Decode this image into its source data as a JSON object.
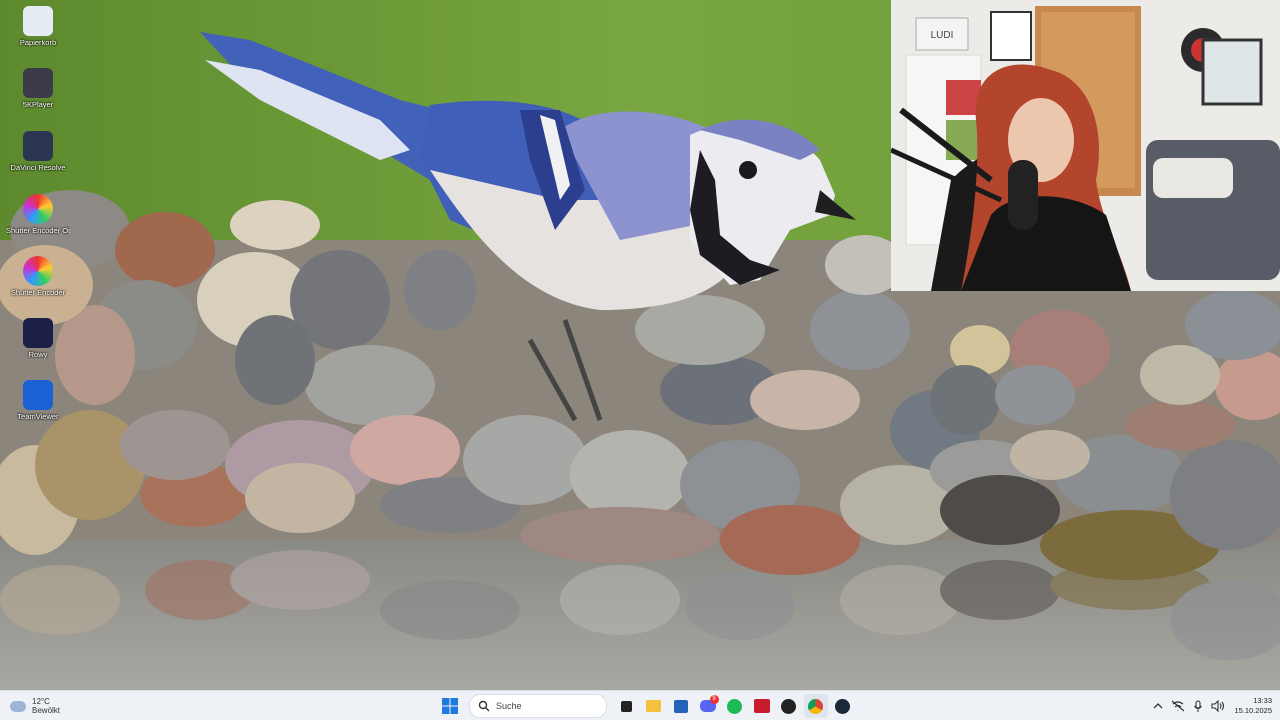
{
  "desktop": {
    "icons": [
      {
        "id": "recycle",
        "label": "Papierkorb"
      },
      {
        "id": "5kplayer",
        "label": "5KPlayer"
      },
      {
        "id": "davinci",
        "label": "DaVinci Resolve"
      },
      {
        "id": "encoder-opencl",
        "label": "Shutter Encoder OpenCL"
      },
      {
        "id": "encoder",
        "label": "Shutter Encoder"
      },
      {
        "id": "rowy",
        "label": "Rowy"
      },
      {
        "id": "teamviewer",
        "label": "TeamViewer"
      }
    ]
  },
  "webcam": {
    "sign_text": "LUDI"
  },
  "taskbar": {
    "weather": {
      "temp": "12°C",
      "condition": "Bewölkt",
      "icon": "cloud-icon"
    },
    "search_placeholder": "Suche",
    "apps": [
      {
        "name": "task-view",
        "icon": "task-view-icon"
      },
      {
        "name": "file-explorer",
        "icon": "folder-icon"
      },
      {
        "name": "store",
        "icon": "store-icon"
      },
      {
        "name": "discord",
        "icon": "discord-icon",
        "badge": "9"
      },
      {
        "name": "spotify",
        "icon": "spotify-icon"
      },
      {
        "name": "voicemod",
        "icon": "voicemod-icon"
      },
      {
        "name": "obs",
        "icon": "obs-icon"
      },
      {
        "name": "chrome",
        "icon": "chrome-icon"
      },
      {
        "name": "steam",
        "icon": "steam-icon"
      }
    ],
    "clock": {
      "time": "13:33",
      "date": "15.10.2025"
    }
  }
}
